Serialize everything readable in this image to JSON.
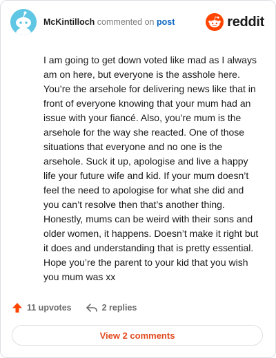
{
  "comment": {
    "author": "McKintilloch",
    "action_text": "commented on",
    "post_link_text": "post",
    "body": "I am going to get down voted like mad as I always am on here, but everyone is the asshole here. You’re the arsehole for delivering news like that in front of everyone knowing that your mum had an issue with your fiancé. Also, you’re mum is the arsehole for the way she reacted. One of those situations that everyone and no one is the arsehole. Suck it up, apologise and live a happy life your future wife and kid. If your mum doesn’t feel the need to apologise for what she did and you can’t resolve then that’s another thing. Honestly, mums can be weird with their sons and older women, it happens. Doesn’t make it right but it does and understanding that is pretty essential. Hope you’re the parent to your kid that you wish you mum was xx"
  },
  "brand": {
    "wordmark": "reddit",
    "color": "#ff4500"
  },
  "actions": {
    "upvotes_label": "11 upvotes",
    "replies_label": "2 replies",
    "upvote_color": "#ff4500"
  },
  "footer": {
    "view_comments_label": "View 2 comments",
    "accent_color": "#e2491e"
  },
  "icons": {
    "avatar": "snoo-avatar",
    "logo": "reddit-snoo-icon",
    "upvote": "upvote-arrow-icon",
    "reply": "reply-arrow-icon"
  }
}
